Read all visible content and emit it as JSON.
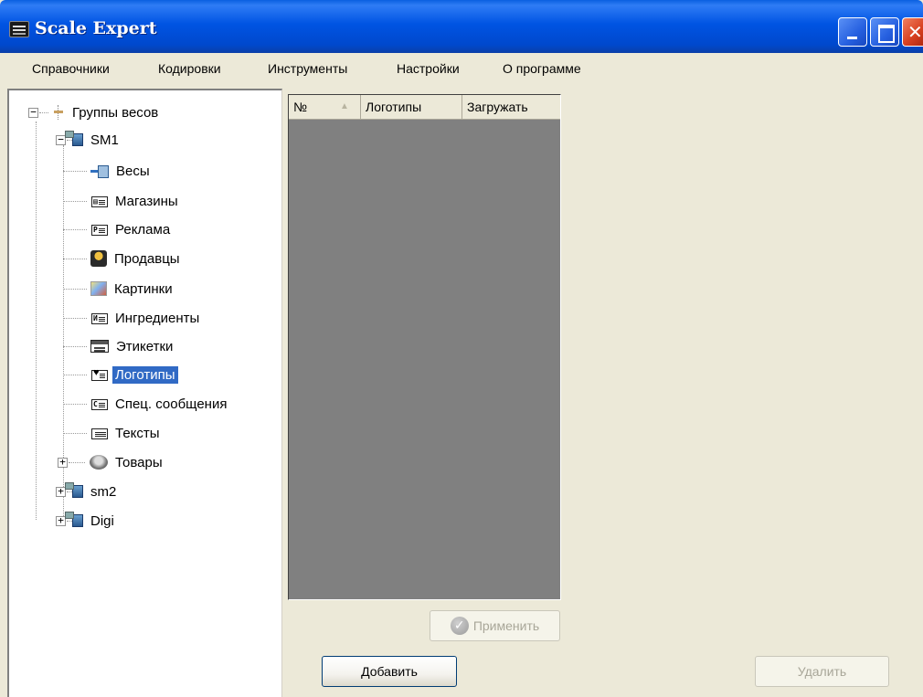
{
  "window": {
    "title": "Scale Expert"
  },
  "menu": [
    "Справочники",
    "Кодировки",
    "Инструменты",
    "Настройки",
    "О программе"
  ],
  "tree": {
    "root": "Группы весов",
    "groups": [
      {
        "name": "SM1",
        "expanded": true,
        "children": [
          {
            "label": "Весы",
            "icon": "scales-icon"
          },
          {
            "label": "Магазины",
            "icon": "shops-icon"
          },
          {
            "label": "Реклама",
            "icon": "advertising-icon"
          },
          {
            "label": "Продавцы",
            "icon": "sellers-icon"
          },
          {
            "label": "Картинки",
            "icon": "pictures-icon"
          },
          {
            "label": "Ингредиенты",
            "icon": "ingredients-icon"
          },
          {
            "label": "Этикетки",
            "icon": "labels-icon"
          },
          {
            "label": "Логотипы",
            "icon": "logos-icon",
            "selected": true
          },
          {
            "label": "Спец. сообщения",
            "icon": "special-messages-icon"
          },
          {
            "label": "Тексты",
            "icon": "texts-icon"
          },
          {
            "label": "Товары",
            "icon": "goods-icon",
            "expandable": true
          }
        ]
      },
      {
        "name": "sm2",
        "expanded": false
      },
      {
        "name": "Digi",
        "expanded": false
      }
    ]
  },
  "grid": {
    "columns": [
      "№",
      "Логотипы",
      "Загружать"
    ],
    "rows": []
  },
  "buttons": {
    "apply": "Применить",
    "add": "Добавить",
    "delete": "Удалить"
  },
  "colors": {
    "titlebar": "#0054e3",
    "selection": "#316ac5",
    "grid_background": "#808080",
    "window_background": "#ece9d8"
  }
}
